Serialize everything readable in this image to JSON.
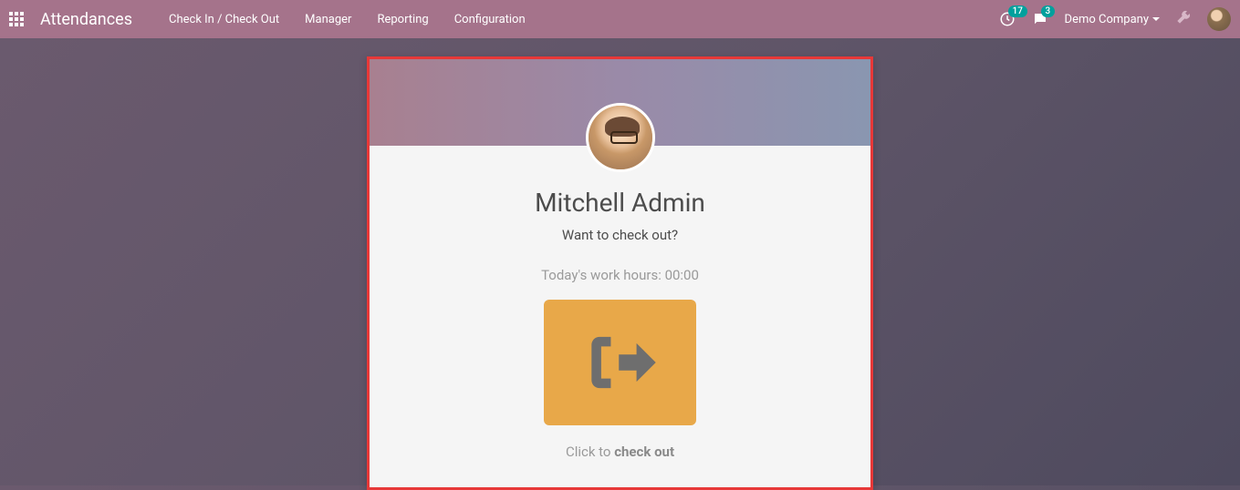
{
  "navbar": {
    "brand": "Attendances",
    "links": {
      "checkin": "Check In / Check Out",
      "manager": "Manager",
      "reporting": "Reporting",
      "configuration": "Configuration"
    },
    "activities_badge": "17",
    "messages_badge": "3",
    "company": "Demo Company"
  },
  "card": {
    "employee_name": "Mitchell Admin",
    "prompt": "Want to check out?",
    "hours_label": "Today's work hours: ",
    "hours_value": "00:00",
    "hint_prefix": "Click to ",
    "hint_action": "check out"
  }
}
